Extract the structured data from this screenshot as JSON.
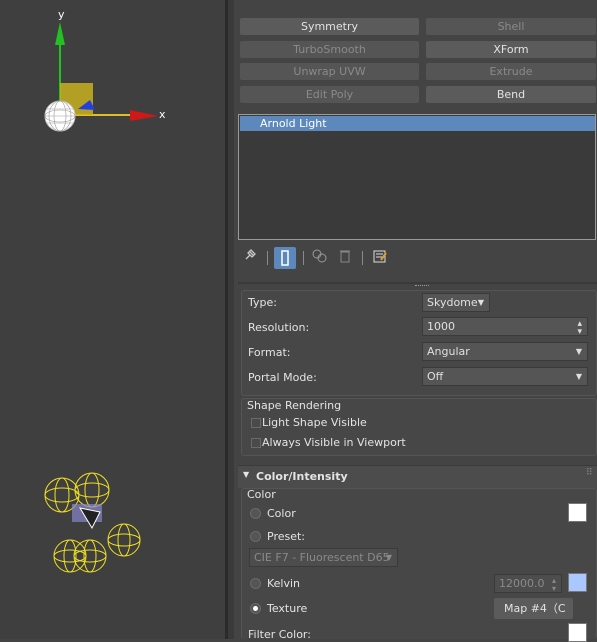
{
  "viewport": {
    "axis_y": "y",
    "axis_x": "x"
  },
  "modifiers": {
    "buttons": [
      {
        "label": "Symmetry",
        "enabled": true
      },
      {
        "label": "Shell",
        "enabled": false
      },
      {
        "label": "TurboSmooth",
        "enabled": false
      },
      {
        "label": "XForm",
        "enabled": true
      },
      {
        "label": "Unwrap UVW",
        "enabled": false
      },
      {
        "label": "Extrude",
        "enabled": false
      },
      {
        "label": "Edit Poly",
        "enabled": false
      },
      {
        "label": "Bend",
        "enabled": true
      }
    ]
  },
  "stack": {
    "selected_item": "Arnold Light"
  },
  "toolbar": {
    "icons": [
      "pin-stack-icon",
      "show-end-result-icon",
      "make-unique-icon",
      "remove-modifier-icon",
      "configure-sets-icon"
    ]
  },
  "general": {
    "type_label": "Type:",
    "type_value": "Skydome",
    "resolution_label": "Resolution:",
    "resolution_value": "1000",
    "format_label": "Format:",
    "format_value": "Angular",
    "portal_label": "Portal Mode:",
    "portal_value": "Off"
  },
  "shape_rendering": {
    "title": "Shape Rendering",
    "opt1": "Light Shape Visible",
    "opt2": "Always Visible in Viewport"
  },
  "color_intensity": {
    "title": "Color/Intensity",
    "group_label": "Color",
    "color_label": "Color",
    "preset_label": "Preset:",
    "preset_value": "CIE F7 - Fluorescent D65",
    "kelvin_label": "Kelvin",
    "kelvin_value": "12000.0",
    "texture_label": "Texture",
    "texture_map": "Map #4（C",
    "filter_label": "Filter Color:",
    "selected_mode": "Texture",
    "swatch_color": "#ffffff",
    "kelvin_swatch_color": "#aac8ff"
  }
}
